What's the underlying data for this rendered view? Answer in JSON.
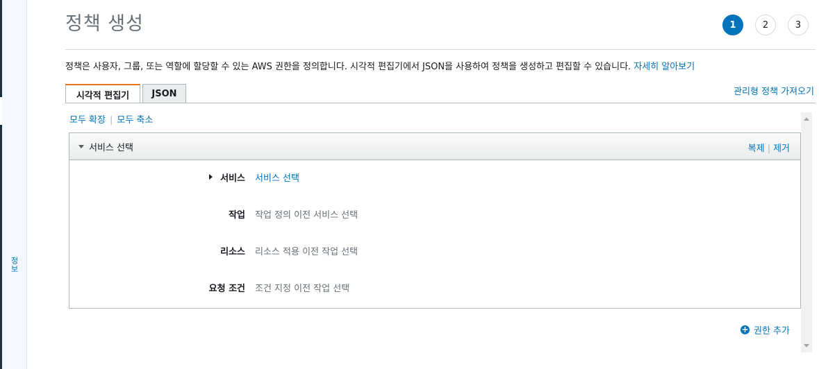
{
  "help_rail": {
    "label": "정보"
  },
  "page": {
    "title": "정책 생성"
  },
  "steps": [
    {
      "label": "1",
      "active": true
    },
    {
      "label": "2",
      "active": false
    },
    {
      "label": "3",
      "active": false
    }
  ],
  "description": {
    "text": "정책은 사용자, 그룹, 또는 역할에 할당할 수 있는 AWS 권한을 정의합니다. 시각적 편집기에서 JSON을 사용하여 정책을 생성하고 편집할 수 있습니다. ",
    "link": "자세히 알아보기"
  },
  "tabs": [
    {
      "label": "시각적 편집기",
      "active": true
    },
    {
      "label": "JSON",
      "active": false
    }
  ],
  "import_link": "관리형 정책 가져오기",
  "expand_controls": {
    "expand_all": "모두 확장",
    "separator": "|",
    "collapse_all": "모두 축소"
  },
  "panel": {
    "title": "서비스 선택",
    "actions": {
      "clone": "복제",
      "separator": "|",
      "remove": "제거"
    },
    "rows": [
      {
        "label": "서비스",
        "value": "서비스 선택",
        "is_link": true
      },
      {
        "label": "작업",
        "value": "작업 정의 이전 서비스 선택",
        "is_link": false
      },
      {
        "label": "리소스",
        "value": "리소스 적용 이전 작업 선택",
        "is_link": false
      },
      {
        "label": "요청 조건",
        "value": "조건 지정 이전 작업 선택",
        "is_link": false
      }
    ]
  },
  "add_permission": {
    "icon": "plus-circle-icon",
    "label": "권한 추가"
  },
  "colors": {
    "accent": "#0073bb",
    "tab_highlight": "#ec7211"
  }
}
